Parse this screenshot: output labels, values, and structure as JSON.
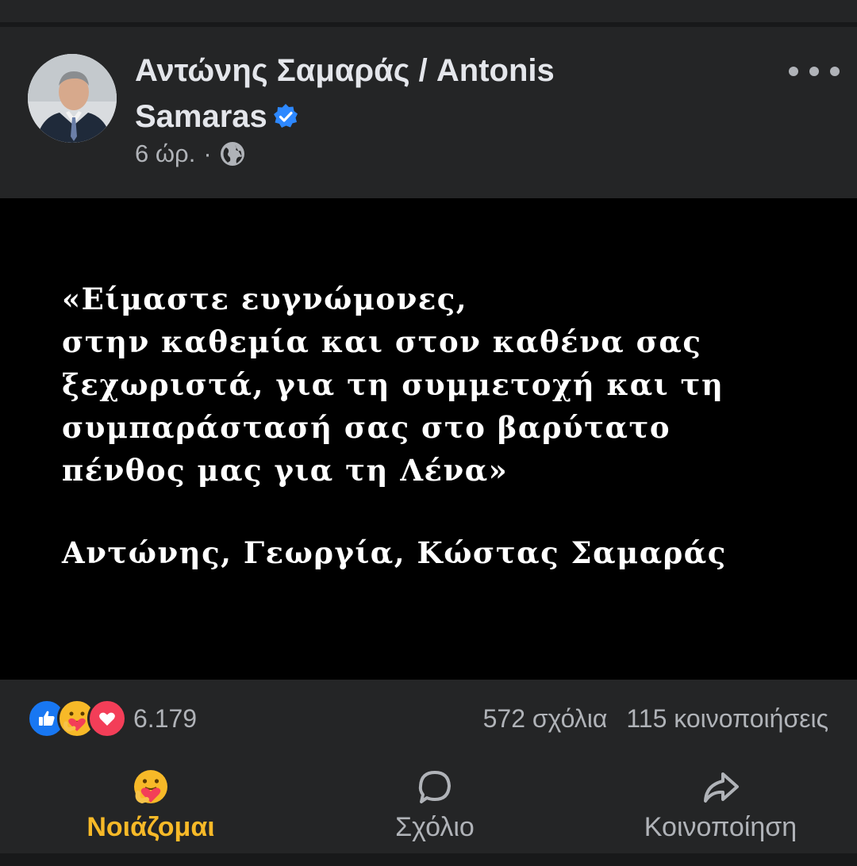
{
  "post": {
    "author": "Αντώνης Σαμαράς /  Antonis Samaras",
    "time": "6 ώρ.",
    "separator": "·"
  },
  "image": {
    "quote": "«Είμαστε ευγνώμονες,\nστην καθεμία και στον καθένα σας\nξεχωριστά, για τη συμμετοχή και τη\nσυμπαράστασή σας στο βαρύτατο\nπένθος μας για τη Λένα»",
    "signature": "Αντώνης, Γεωργία, Κώστας Σαμαράς"
  },
  "reactions": {
    "count": "6.179",
    "icons": [
      "like-icon",
      "care-icon",
      "love-icon"
    ]
  },
  "engagement": {
    "comments": "572 σχόλια",
    "shares": "115 κοινοποιήσεις"
  },
  "actions": {
    "care_label": "Νοιάζομαι",
    "comment_label": "Σχόλιο",
    "share_label": "Κοινοποίηση"
  },
  "colors": {
    "background": "#242526",
    "accent_care": "#f7b928",
    "verified": "#2d88ff",
    "like": "#1877f2",
    "love": "#f33e58"
  }
}
